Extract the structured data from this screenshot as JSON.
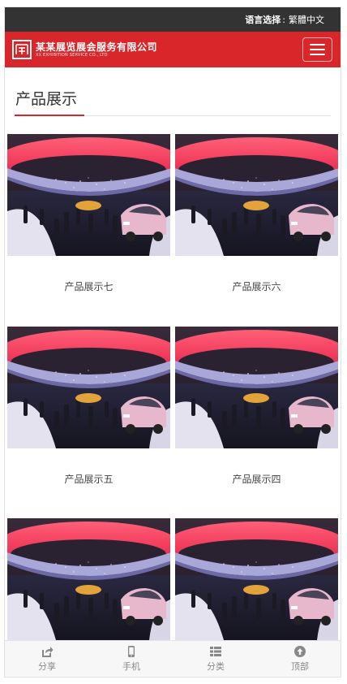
{
  "topbar": {
    "language_label": "语言选择",
    "language_sep": ":",
    "language_option": "繁體中文"
  },
  "header": {
    "logo_cn": "某某展览展会服务有限公司",
    "logo_en": "XX EXHIBITION SERVICE CO., LTD",
    "menu_icon": "hamburger-menu-icon"
  },
  "section": {
    "title": "产品展示"
  },
  "products": [
    {
      "caption": "产品展示七"
    },
    {
      "caption": "产品展示六"
    },
    {
      "caption": "产品展示五"
    },
    {
      "caption": "产品展示四"
    },
    {
      "caption": ""
    },
    {
      "caption": ""
    }
  ],
  "bottom_nav": [
    {
      "label": "分享",
      "icon": "share-icon"
    },
    {
      "label": "手机",
      "icon": "mobile-phone-icon"
    },
    {
      "label": "分类",
      "icon": "category-list-icon"
    },
    {
      "label": "顶部",
      "icon": "arrow-up-circle-icon"
    }
  ],
  "colors": {
    "brand_red": "#d9262a",
    "topbar_bg": "#333333"
  }
}
